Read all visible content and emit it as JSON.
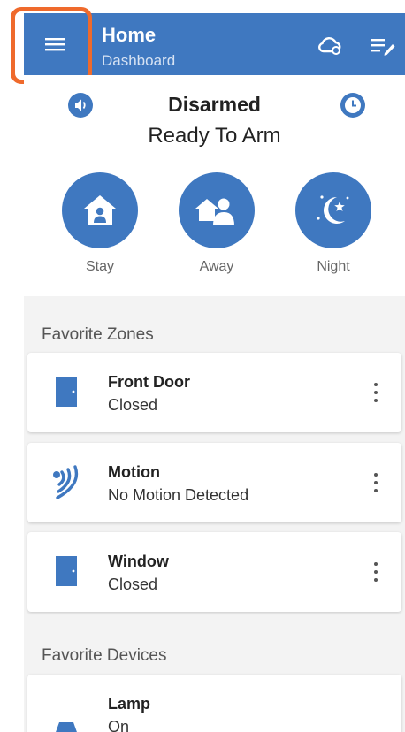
{
  "app_bar": {
    "title": "Home",
    "subtitle": "Dashboard",
    "menu_icon": "hamburger-menu-icon",
    "cloud_icon": "cloud-sync-icon",
    "list_icon": "edit-list-icon"
  },
  "status": {
    "state": "Disarmed",
    "detail": "Ready To Arm"
  },
  "arm_modes": [
    {
      "label": "Stay",
      "icon": "house-person-icon"
    },
    {
      "label": "Away",
      "icon": "house-people-icon"
    },
    {
      "label": "Night",
      "icon": "moon-stars-icon"
    }
  ],
  "zones": {
    "heading": "Favorite Zones",
    "items": [
      {
        "name": "Front Door",
        "state": "Closed",
        "icon": "door-icon"
      },
      {
        "name": "Motion",
        "state": "No Motion Detected",
        "icon": "motion-sensor-icon"
      },
      {
        "name": "Window",
        "state": "Closed",
        "icon": "door-icon"
      }
    ]
  },
  "devices": {
    "heading": "Favorite Devices",
    "items": [
      {
        "name": "Lamp",
        "state": "On",
        "icon": "lamp-icon"
      }
    ]
  },
  "colors": {
    "primary": "#3f78c0",
    "highlight": "#ef6a2c",
    "background": "#f3f3f3"
  }
}
